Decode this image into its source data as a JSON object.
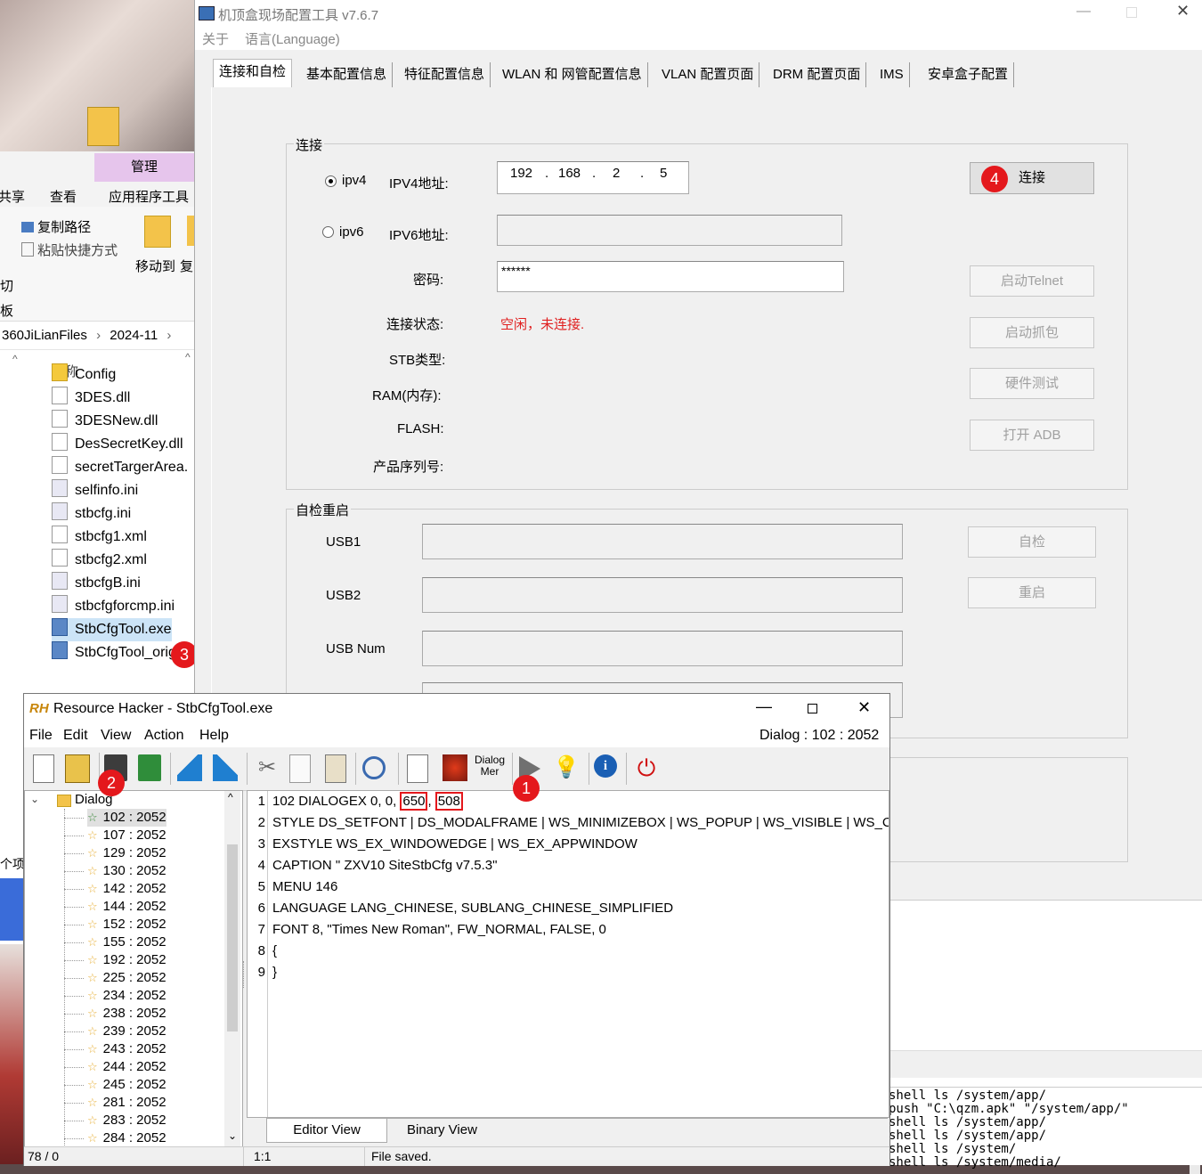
{
  "explorer": {
    "ribbon_manage": "管理",
    "ribbon_tabs": [
      "共享",
      "查看",
      "应用程序工具"
    ],
    "copy_path": "复制路径",
    "paste_shortcut": "粘贴快捷方式",
    "cut_partial": "切",
    "clipboard_partial": "板",
    "move_to": "移动到",
    "copy_to_partial": "复",
    "breadcrumb": [
      "360JiLianFiles",
      "2024-11"
    ],
    "column_name": "名称",
    "items_count_partial": "个项",
    "files": [
      {
        "name": "Config",
        "type": "folder"
      },
      {
        "name": "3DES.dll",
        "type": "dll"
      },
      {
        "name": "3DESNew.dll",
        "type": "dll"
      },
      {
        "name": "DesSecretKey.dll",
        "type": "dll"
      },
      {
        "name": "secretTargerArea.",
        "type": "dll"
      },
      {
        "name": "selfinfo.ini",
        "type": "ini"
      },
      {
        "name": "stbcfg.ini",
        "type": "ini"
      },
      {
        "name": "stbcfg1.xml",
        "type": "file"
      },
      {
        "name": "stbcfg2.xml",
        "type": "file"
      },
      {
        "name": "stbcfgB.ini",
        "type": "ini"
      },
      {
        "name": "stbcfgforcmp.ini",
        "type": "ini"
      },
      {
        "name": "StbCfgTool.exe",
        "type": "exe"
      },
      {
        "name": "StbCfgTool_origin",
        "type": "exe"
      }
    ]
  },
  "badges": {
    "b1": "1",
    "b2": "2",
    "b3": "3",
    "b4": "4"
  },
  "cfg": {
    "title": "机顶盒现场配置工具 v7.6.7",
    "menu": [
      "关于",
      "语言(Language)"
    ],
    "tabs": [
      "连接和自检",
      "基本配置信息",
      "特征配置信息",
      "WLAN 和 网管配置信息",
      "VLAN 配置页面",
      "DRM 配置页面",
      "IMS",
      "安卓盒子配置"
    ],
    "connect_group": "连接",
    "ipv4_radio": "ipv4",
    "ipv4_label": "IPV4地址:",
    "ip": [
      "192",
      "168",
      "2",
      "5"
    ],
    "ipv6_radio": "ipv6",
    "ipv6_label": "IPV6地址:",
    "password_label": "密码:",
    "password_value": "******",
    "status_label": "连接状态:",
    "status_value": "空闲，未连接.",
    "stb_type_label": "STB类型:",
    "ram_label": "RAM(内存):",
    "flash_label": "FLASH:",
    "serial_label": "产品序列号:",
    "btn_connect": "连接",
    "btn_telnet": "启动Telnet",
    "btn_capture": "启动抓包",
    "btn_hwtest": "硬件测试",
    "btn_adb": "打开 ADB",
    "selfcheck_group": "自检重启",
    "usb1": "USB1",
    "usb2": "USB2",
    "usbnum": "USB Num",
    "btn_selfcheck": "自检",
    "btn_reboot": "重启"
  },
  "console": [
    "shell ls /system/app/",
    "push \"C:\\qzm.apk\"  \"/system/app/\"",
    "shell ls /system/app/",
    "shell ls /system/app/",
    "shell ls /system/",
    "shell ls /system/media/"
  ],
  "rh": {
    "title": "Resource Hacker - StbCfgTool.exe",
    "menu": [
      "File",
      "Edit",
      "View",
      "Action",
      "Help"
    ],
    "dialog_info": "Dialog : 102 : 2052",
    "dialog_menu_btn": "Dialog\nMer",
    "tree_root": "Dialog",
    "tree_items": [
      "102 : 2052",
      "107 : 2052",
      "129 : 2052",
      "130 : 2052",
      "142 : 2052",
      "144 : 2052",
      "152 : 2052",
      "155 : 2052",
      "192 : 2052",
      "225 : 2052",
      "234 : 2052",
      "238 : 2052",
      "239 : 2052",
      "243 : 2052",
      "244 : 2052",
      "245 : 2052",
      "281 : 2052",
      "283 : 2052",
      "284 : 2052"
    ],
    "code_prefix": "102 DIALOGEX 0, 0, ",
    "code_w": "650",
    "code_sep": ", ",
    "code_h": "508",
    "code_lines": [
      "STYLE DS_SETFONT | DS_MODALFRAME | WS_MINIMIZEBOX | WS_POPUP | WS_VISIBLE | WS_CAPT",
      "EXSTYLE WS_EX_WINDOWEDGE | WS_EX_APPWINDOW",
      "CAPTION \" ZXV10 SiteStbCfg v7.5.3\"",
      "MENU 146",
      "LANGUAGE LANG_CHINESE, SUBLANG_CHINESE_SIMPLIFIED",
      "FONT 8, \"Times New Roman\", FW_NORMAL, FALSE, 0",
      "{",
      "}"
    ],
    "line_numbers": [
      "1",
      "2",
      "3",
      "4",
      "5",
      "6",
      "7",
      "8",
      "9"
    ],
    "tab_editor": "Editor View",
    "tab_binary": "Binary View",
    "status_count": "78 / 0",
    "status_pos": "1:1",
    "status_msg": "File saved."
  }
}
